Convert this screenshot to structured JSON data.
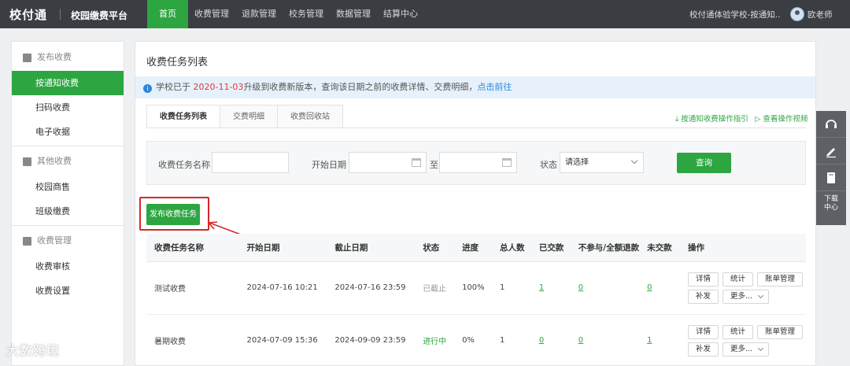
{
  "header": {
    "logo": "校付通",
    "platform": "校园缴费平台",
    "nav": [
      "首页",
      "收费管理",
      "退款管理",
      "校务管理",
      "数据管理",
      "结算中心"
    ],
    "school": "校付通体验学校-按通知...",
    "user": "欧老师"
  },
  "sidebar": {
    "groups": [
      {
        "title": "发布收费",
        "items": [
          "按通知收费",
          "扫码收费",
          "电子收据"
        ]
      },
      {
        "title": "其他收费",
        "items": [
          "校园商售",
          "班级缴费"
        ]
      },
      {
        "title": "收费管理",
        "items": [
          "收费审核",
          "收费设置"
        ]
      }
    ],
    "active_item": "按通知收费"
  },
  "main": {
    "title": "收费任务列表",
    "notice": {
      "prefix": "学校已于",
      "date": "2020-11-03",
      "suffix": "升级到收费新版本，查询该日期之前的收费详情、交费明细，",
      "link": "点击前往"
    },
    "tabs": [
      "收费任务列表",
      "交费明细",
      "收费回收站"
    ],
    "links": {
      "guide": "按通知收费操作指引",
      "video": "查看操作视频"
    },
    "filter": {
      "name_label": "收费任务名称",
      "start_label": "开始日期",
      "to_label": "至",
      "status_label": "状态",
      "status_value": "请选择",
      "query_button": "查询"
    },
    "publish_button": "发布收费任务"
  },
  "table": {
    "columns": [
      "收费任务名称",
      "开始日期",
      "截止日期",
      "状态",
      "进度",
      "总人数",
      "已交款",
      "不参与/全额退款",
      "未交款",
      "操作"
    ],
    "rows": [
      {
        "name": "测试收费",
        "start": "2024-07-16 10:21",
        "end": "2024-07-16 23:59",
        "status": "已截止",
        "progress": "100%",
        "total": "1",
        "paid": "1",
        "refund": "0",
        "unpaid": "0"
      },
      {
        "name": "暑期收费",
        "start": "2024-07-09 15:36",
        "end": "2024-09-09 23:59",
        "status": "进行中",
        "progress": "0%",
        "total": "1",
        "paid": "0",
        "refund": "0",
        "unpaid": "1"
      }
    ],
    "actions": [
      "详情",
      "统计",
      "账单管理",
      "补发",
      "更多..."
    ]
  },
  "rail": {
    "download": "下载中心"
  },
  "watermark": "大数跨境",
  "colors": {
    "primary": "#2da641",
    "topbar": "#3a3d42",
    "notice_bg": "#e6f1fb",
    "highlight": "#d62828"
  }
}
